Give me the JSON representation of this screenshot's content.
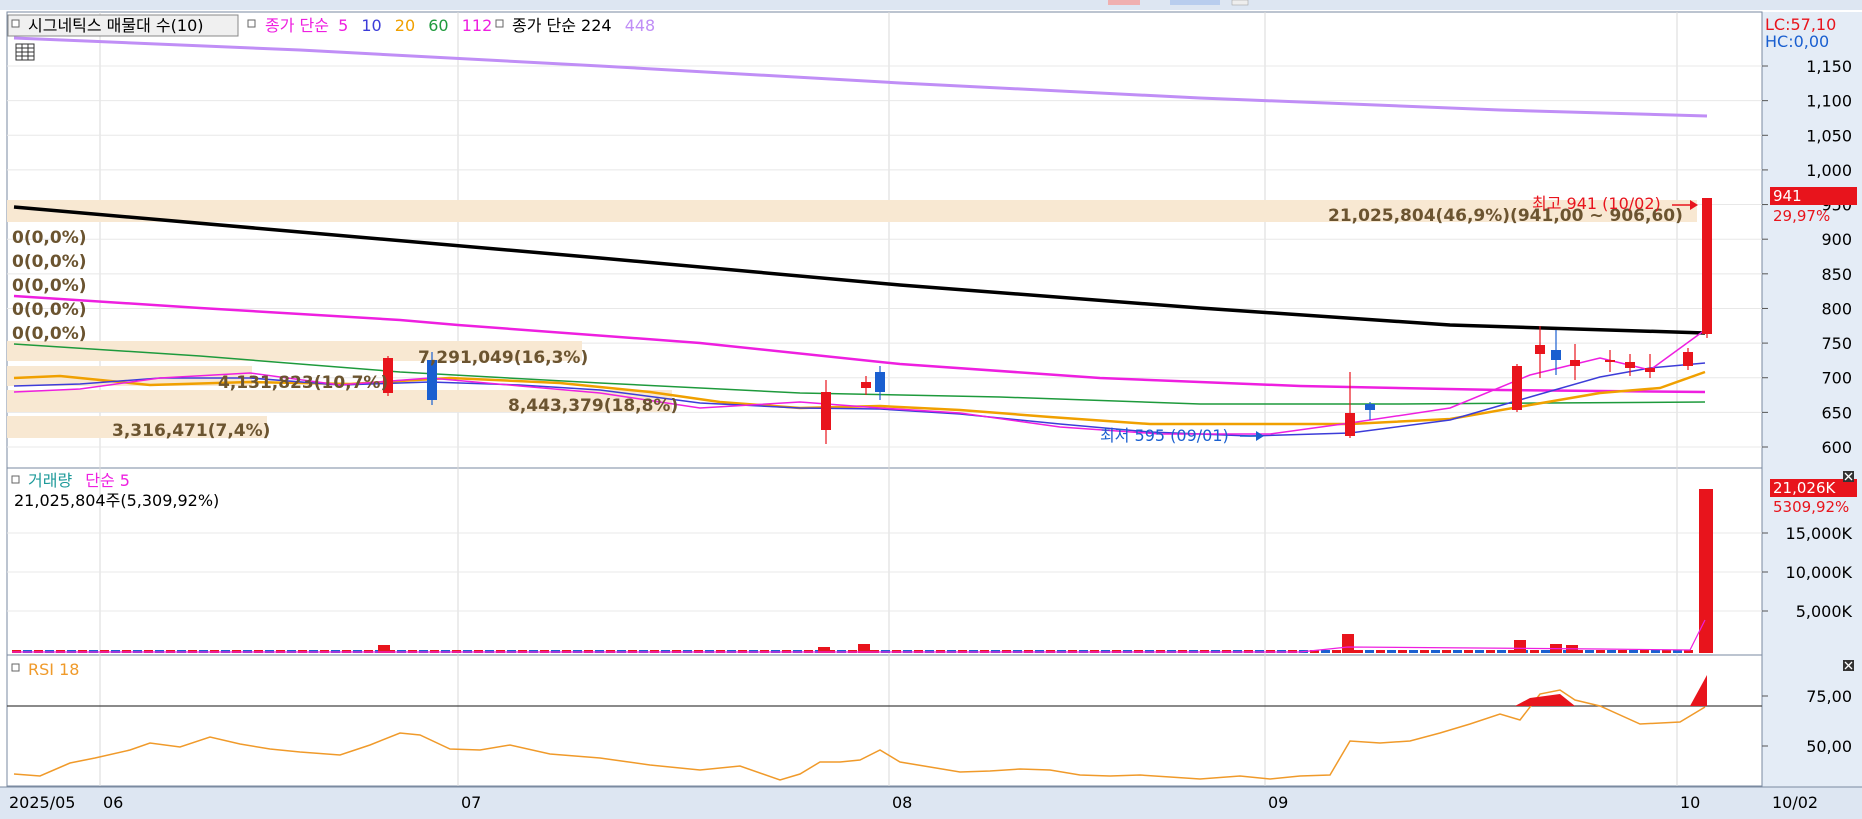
{
  "colors": {
    "accent_red": "#e8141c",
    "accent_blue": "#1a5fd0",
    "axis_bg": "#e4ecf6",
    "grid": "#d8d8d8",
    "ma5": "#ee1fe0",
    "ma10": "#3c3cd8",
    "ma20": "#f0a000",
    "ma60": "#1e9a3c",
    "ma112": "#ee1fe0",
    "ma224": "#000000",
    "ma448": "#c08ef6",
    "profile_band": "#f8e8d2",
    "rsi_line": "#f09a2a"
  },
  "price_panel": {
    "indicator_title": "시그네틱스 매물대 수(10)",
    "ma_simple_label": "종가 단순",
    "ma_periods": [
      "5",
      "10",
      "20",
      "60",
      "112"
    ],
    "ma2_label": "종가 단순 224",
    "ma2_extra": "448",
    "lc_label": "LC:57,10",
    "hc_label": "HC:0,00",
    "high_marker": "최고 941 (10/02)",
    "low_marker": "최저 595 (09/01)",
    "current_price": "941",
    "current_change": "29,97%",
    "zero_labels": [
      "0(0,0%)",
      "0(0,0%)",
      "0(0,0%)",
      "0(0,0%)",
      "0(0,0%)"
    ],
    "profile_labels": {
      "top": "21,025,804(46,9%)(941,00 ~ 906,60)",
      "a": "7,291,049(16,3%)",
      "b": "4,131,823(10,7%)",
      "c": "8,443,379(18,8%)",
      "d": "3,316,471(7,4%)"
    },
    "y_ticks": [
      "1,150",
      "1,100",
      "1,050",
      "1,000",
      "950",
      "900",
      "850",
      "800",
      "750",
      "700",
      "650",
      "600"
    ]
  },
  "volume_panel": {
    "title": "거래량",
    "ma_label": "단순 5",
    "summary": "21,025,804주(5,309,92%)",
    "current_value": "21,026K",
    "current_pct": "5309,92%",
    "y_ticks": [
      "15,000K",
      "10,000K",
      "5,000K"
    ]
  },
  "rsi_panel": {
    "title": "RSI 18",
    "y_ticks": [
      "75,00",
      "50,00"
    ]
  },
  "x_axis": {
    "labels": [
      "2025/05",
      "06",
      "07",
      "08",
      "09",
      "10"
    ],
    "last_date": "10/02"
  }
}
